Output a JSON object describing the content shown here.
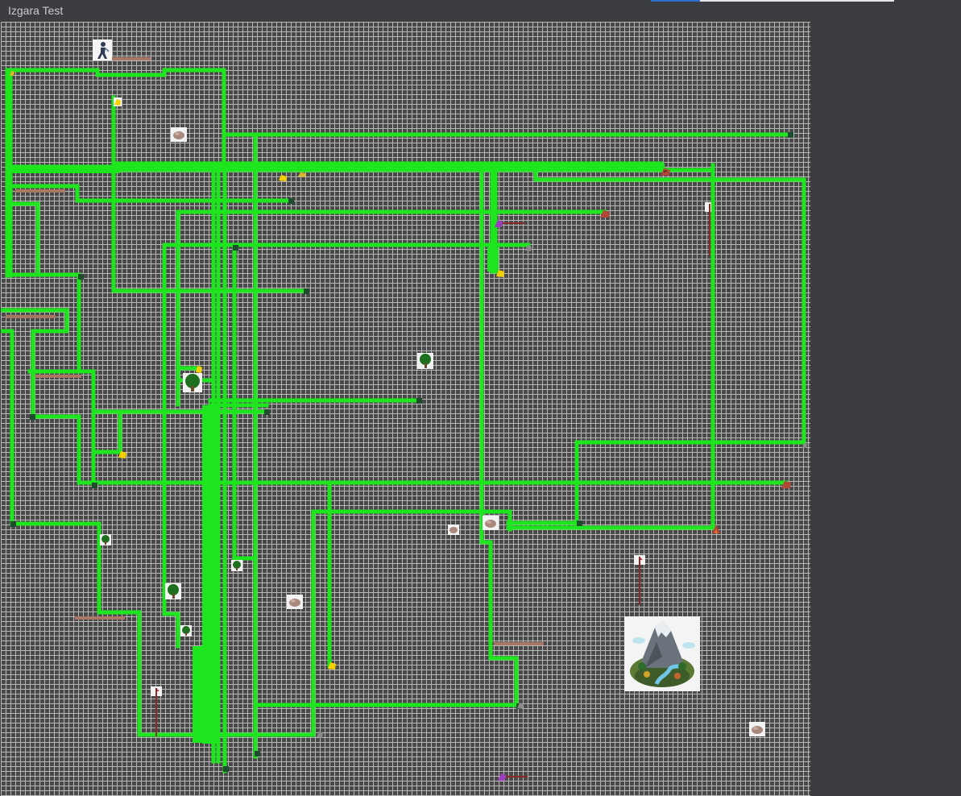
{
  "window": {
    "title": "Izgara Test"
  },
  "colors": {
    "grid_background": "#494949",
    "grid_lines": "#b9b9b9",
    "path": "#1ee61e",
    "path_node": "#1d4d2c",
    "window_chrome": "#3b3d41"
  },
  "sprites": {
    "player": "person-icon",
    "resources": [
      "rock-icon",
      "tree-icon",
      "gold-ore-icon",
      "iron-ore-icon",
      "purple-crystal-icon"
    ],
    "structures": [
      "flag-icon",
      "campfire-icon",
      "mountain-island-icon"
    ]
  }
}
